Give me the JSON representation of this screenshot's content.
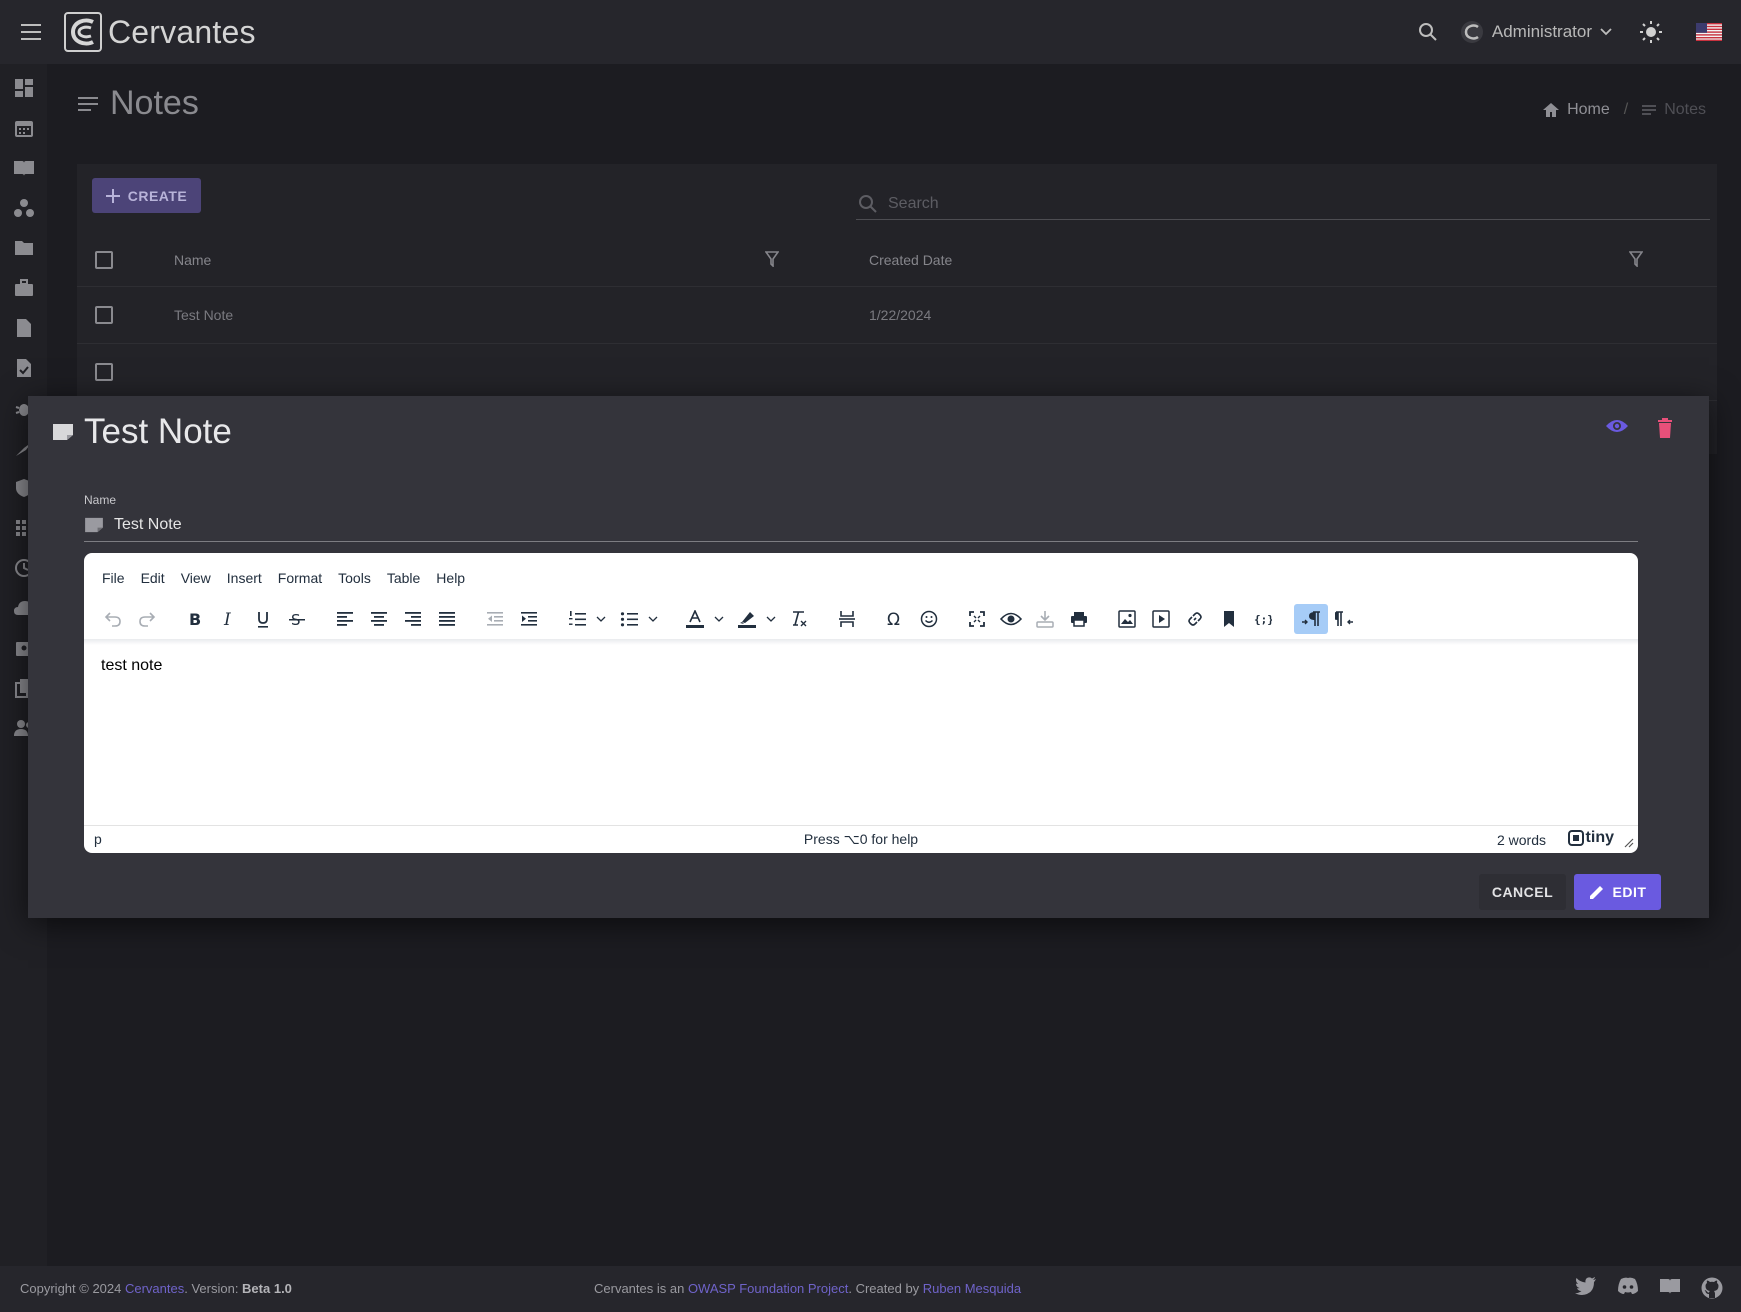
{
  "app": {
    "title": "Cervantes"
  },
  "topbar": {
    "user_name": "Administrator"
  },
  "page": {
    "title": "Notes",
    "breadcrumb": {
      "home": "Home",
      "current": "Notes"
    }
  },
  "list": {
    "create_label": "CREATE",
    "search_placeholder": "Search",
    "columns": [
      "Name",
      "Created Date"
    ],
    "rows": [
      {
        "name": "Test Note",
        "created": "1/22/2024"
      },
      {
        "name": "",
        "created": ""
      }
    ]
  },
  "modal": {
    "title": "Test Note",
    "name_label": "Name",
    "name_value": "Test Note",
    "editor": {
      "menus": [
        "File",
        "Edit",
        "View",
        "Insert",
        "Format",
        "Tools",
        "Table",
        "Help"
      ],
      "content": "test note",
      "status_path": "p",
      "status_help": "Press ⌥0 for help",
      "word_count": "2 words",
      "brand": "tiny"
    },
    "cancel_label": "CANCEL",
    "edit_label": "EDIT"
  },
  "footer": {
    "copyright": "Copyright © 2024 ",
    "app_link": "Cervantes",
    "version_label": ". Version: ",
    "version": "Beta 1.0",
    "mid_prefix": "Cervantes is an ",
    "owasp_link": "OWASP Foundation Project",
    "mid_middle": ". Created by ",
    "author_link": "Ruben Mesquida"
  },
  "colors": {
    "accent": "#6a5ae0",
    "danger": "#e8507a",
    "background": "#1c1c21",
    "modal": "#34343b"
  }
}
